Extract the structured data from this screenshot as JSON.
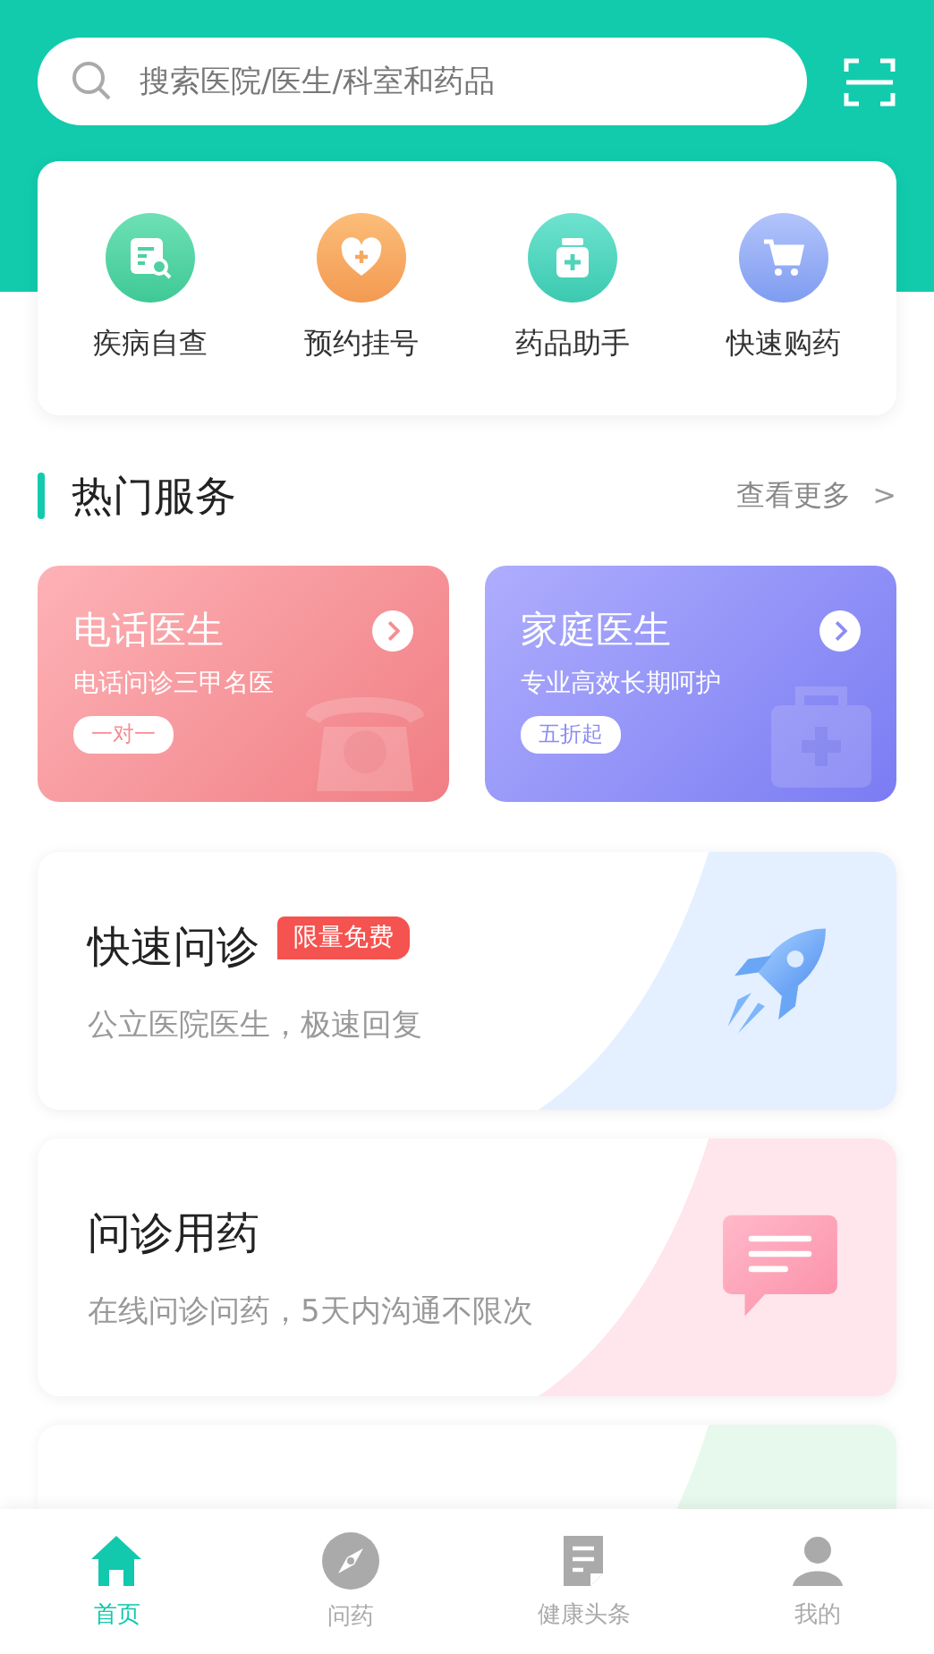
{
  "search": {
    "placeholder": "搜索医院/医生/科室和药品"
  },
  "quick_services": [
    {
      "label": "疾病自查",
      "kind": "check"
    },
    {
      "label": "预约挂号",
      "kind": "heart"
    },
    {
      "label": "药品助手",
      "kind": "medicine"
    },
    {
      "label": "快速购药",
      "kind": "cart"
    }
  ],
  "hot_services": {
    "title": "热门服务",
    "more": "查看更多",
    "more_icon": ">",
    "cards": [
      {
        "title": "电话医生",
        "subtitle": "电话问诊三甲名医",
        "tag": "一对一",
        "kind": "phone"
      },
      {
        "title": "家庭医生",
        "subtitle": "专业高效长期呵护",
        "tag": "五折起",
        "kind": "family"
      }
    ]
  },
  "features": [
    {
      "title": "快速问诊",
      "badge": "限量免费",
      "subtitle": "公立医院医生，极速回复",
      "kind": "rocket"
    },
    {
      "title": "问诊用药",
      "subtitle": "在线问诊问药，5天内沟通不限次",
      "kind": "chat"
    },
    {
      "kind": "green"
    }
  ],
  "tabs": [
    {
      "label": "首页",
      "kind": "home",
      "selected": true
    },
    {
      "label": "问药",
      "kind": "compass",
      "selected": false
    },
    {
      "label": "健康头条",
      "kind": "news",
      "selected": false
    },
    {
      "label": "我的",
      "kind": "user",
      "selected": false
    }
  ]
}
